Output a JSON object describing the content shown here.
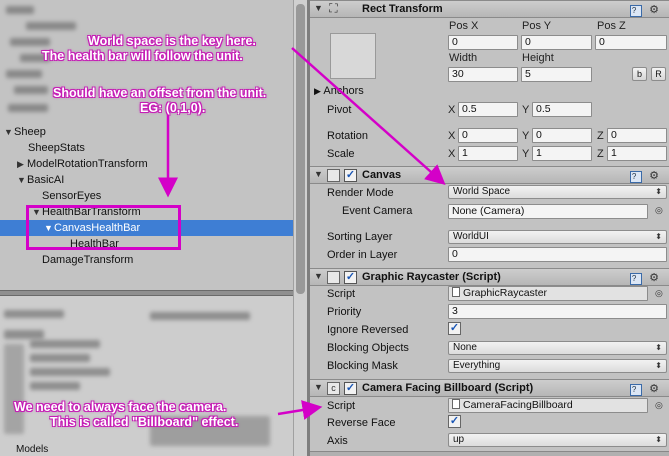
{
  "hierarchy": {
    "items": [
      {
        "label": "Sheep",
        "expanded": true
      },
      {
        "label": "SheepStats"
      },
      {
        "label": "ModelRotationTransform"
      },
      {
        "label": "BasicAI"
      },
      {
        "label": "SensorEyes"
      },
      {
        "label": "HealthBarTransform"
      },
      {
        "label": "CanvasHealthBar",
        "selected": true
      },
      {
        "label": "HealthBar"
      },
      {
        "label": "DamageTransform"
      }
    ],
    "bottom_label": "Models"
  },
  "inspector": {
    "rect_transform": {
      "title": "Rect Transform",
      "pos_x_label": "Pos X",
      "pos_y_label": "Pos Y",
      "pos_z_label": "Pos Z",
      "pos_x": "0",
      "pos_y": "0",
      "pos_z": "0",
      "width_label": "Width",
      "height_label": "Height",
      "width": "30",
      "height": "5",
      "blueprint_btn": "b",
      "raw_btn": "R",
      "anchors_label": "Anchors",
      "pivot_label": "Pivot",
      "pivot_x": "0.5",
      "pivot_y": "0.5",
      "rotation_label": "Rotation",
      "rot_x": "0",
      "rot_y": "0",
      "rot_z": "0",
      "scale_label": "Scale",
      "scale_x": "1",
      "scale_y": "1",
      "scale_z": "1",
      "axis_x": "X",
      "axis_y": "Y",
      "axis_z": "Z"
    },
    "canvas": {
      "title": "Canvas",
      "render_mode_label": "Render Mode",
      "render_mode": "World Space",
      "event_camera_label": "Event Camera",
      "event_camera": "None (Camera)",
      "sorting_layer_label": "Sorting Layer",
      "sorting_layer": "WorldUI",
      "order_in_layer_label": "Order in Layer",
      "order_in_layer": "0"
    },
    "graphic_raycaster": {
      "title": "Graphic Raycaster (Script)",
      "script_label": "Script",
      "script": "GraphicRaycaster",
      "priority_label": "Priority",
      "priority": "3",
      "ignore_reversed_label": "Ignore Reversed",
      "blocking_objects_label": "Blocking Objects",
      "blocking_objects": "None",
      "blocking_mask_label": "Blocking Mask",
      "blocking_mask": "Everything"
    },
    "billboard": {
      "title": "Camera Facing Billboard (Script)",
      "script_label": "Script",
      "script": "CameraFacingBillboard",
      "reverse_face_label": "Reverse Face",
      "axis_label": "Axis",
      "axis": "up"
    }
  },
  "annotations": {
    "world_space_1": "World space is the key here.",
    "world_space_2": "The health bar will follow the unit.",
    "offset_1": "Should have an offset from the unit.",
    "offset_2": "EG: (0,1,0).",
    "billboard_1": "We need to always face the camera.",
    "billboard_2": "This is called \"Billboard\" effect."
  },
  "colors": {
    "annotation": "#d400c8",
    "selection": "#3e7ed4"
  }
}
